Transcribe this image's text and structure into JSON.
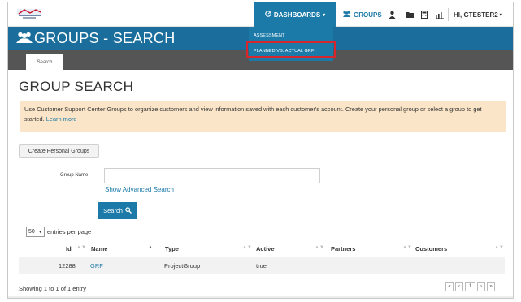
{
  "nav": {
    "dashboards_label": "DASHBOARDS",
    "groups_label": "GROUPS",
    "user_label": "HI, GTESTER2",
    "dropdown": [
      "ASSESSMENT",
      "PLANNED VS. ACTUAL GRF"
    ]
  },
  "header": {
    "title": "GROUPS - SEARCH",
    "subtab": "Search"
  },
  "page": {
    "heading": "GROUP SEARCH",
    "info_text": "Use Customer Support Center Groups to organize customers and view information saved with each customer's account. Create your personal group or select a group to get started.",
    "info_link": "Learn more",
    "create_button": "Create Personal Groups",
    "group_name_label": "Group Name",
    "group_name_value": "",
    "advanced_link": "Show Advanced Search",
    "search_button": "Search"
  },
  "table": {
    "per_page_value": "50",
    "per_page_label": "entries per page",
    "columns": [
      "Id",
      "Name",
      "Type",
      "Active",
      "Partners",
      "Customers"
    ],
    "rows": [
      {
        "id": "12288",
        "name": "GRF",
        "type": "ProjectGroup",
        "active": "true",
        "partners": "",
        "customers": ""
      }
    ],
    "showing": "Showing 1 to 1 of 1 entry",
    "pager": [
      "«",
      "‹",
      "1",
      "›",
      "»"
    ]
  },
  "colors": {
    "brand_blue": "#1b7aa8",
    "header_blue": "#1b6e9c",
    "highlight_red": "#d7262d",
    "info_bg": "#fbe5c8"
  }
}
